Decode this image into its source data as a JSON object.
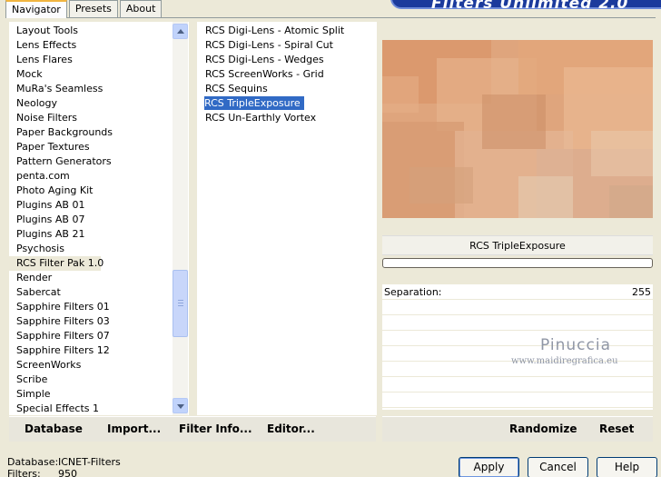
{
  "tabs": [
    {
      "label": "Navigator",
      "active": true
    },
    {
      "label": "Presets",
      "active": false
    },
    {
      "label": "About",
      "active": false
    }
  ],
  "banner": {
    "title": "Filters Unlimited 2.0"
  },
  "categories": [
    "Layout Tools",
    "Lens Effects",
    "Lens Flares",
    "Mock",
    "MuRa's Seamless",
    "Neology",
    "Noise Filters",
    "Paper Backgrounds",
    "Paper Textures",
    "Pattern Generators",
    "penta.com",
    "Photo Aging Kit",
    "Plugins AB 01",
    "Plugins AB 07",
    "Plugins AB 21",
    "Psychosis",
    "RCS Filter Pak 1.0",
    "Render",
    "Sabercat",
    "Sapphire Filters 01",
    "Sapphire Filters 03",
    "Sapphire Filters 07",
    "Sapphire Filters 12",
    "ScreenWorks",
    "Scribe",
    "Simple",
    "Special Effects 1"
  ],
  "selected_category": "RCS Filter Pak 1.0",
  "filters": [
    "RCS Digi-Lens - Atomic Split",
    "RCS Digi-Lens - Spiral Cut",
    "RCS Digi-Lens - Wedges",
    "RCS ScreenWorks - Grid",
    "RCS Sequins",
    "RCS TripleExposure",
    "RCS Un-Earthly Vortex"
  ],
  "selected_filter": "RCS TripleExposure",
  "preview": {
    "filter_name": "RCS TripleExposure",
    "progress": 0
  },
  "parameters": [
    {
      "label": "Separation:",
      "value": "255"
    }
  ],
  "watermark": {
    "name": "Pinuccia",
    "url": "www.maidiregrafica.eu"
  },
  "left_toolbar": {
    "database": "Database",
    "import": "Import...",
    "filter_info": "Filter Info...",
    "editor": "Editor..."
  },
  "right_toolbar": {
    "randomize": "Randomize",
    "reset": "Reset"
  },
  "status": {
    "database_label": "Database:",
    "database_value": "ICNET-Filters",
    "filters_label": "Filters:",
    "filters_value": "950"
  },
  "buttons": {
    "apply": "Apply",
    "cancel": "Cancel",
    "help": "Help"
  },
  "colors": {
    "selection": "#316ac5",
    "window_bg": "#ece9d8",
    "banner": "#1b3a9c"
  },
  "icons": {
    "scroll_up": "chevron-up-icon",
    "scroll_down": "chevron-down-icon"
  }
}
